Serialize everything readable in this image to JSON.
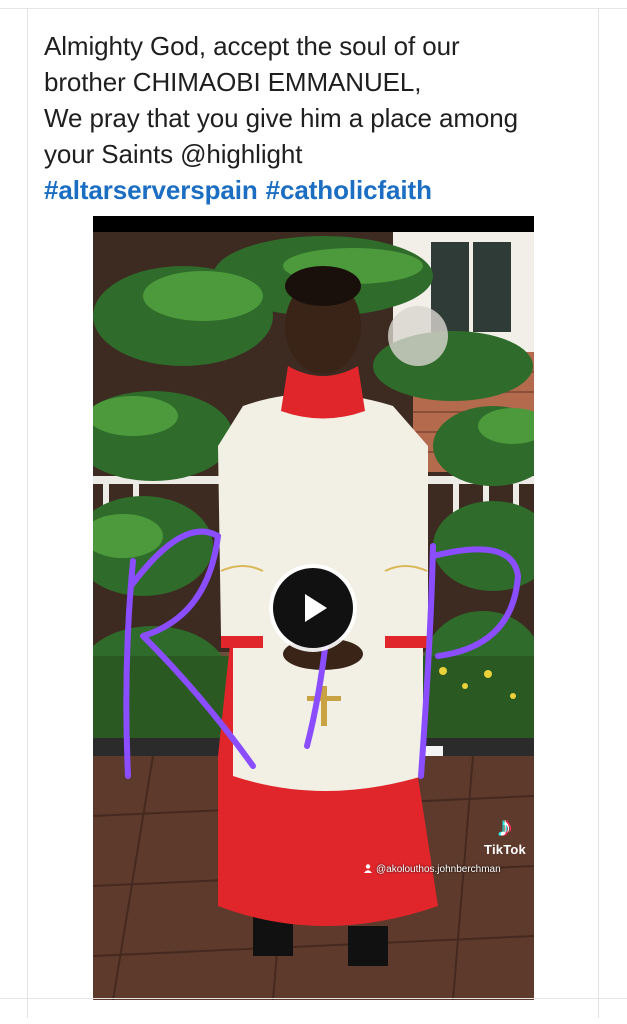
{
  "post": {
    "lines": [
      "Almighty God, accept the soul of our",
      "brother CHIMAOBI EMMANUEL,",
      "We pray that you give him a place among",
      "your Saints @highlight"
    ],
    "hashtags": [
      "#altarserverspain",
      "#catholicfaith"
    ]
  },
  "video": {
    "overlay_letters": [
      "R",
      "I",
      "P"
    ],
    "watermark": {
      "brand": "TikTok",
      "handle": "@akolouthos.johnberchman"
    },
    "icons": {
      "play": "play-icon",
      "tiktok": "tiktok-logo-icon",
      "user": "user-icon"
    }
  },
  "colors": {
    "hashtag": "#1b6ec2",
    "rip_stroke": "#8a4dff",
    "cassock": "#e0262b"
  }
}
